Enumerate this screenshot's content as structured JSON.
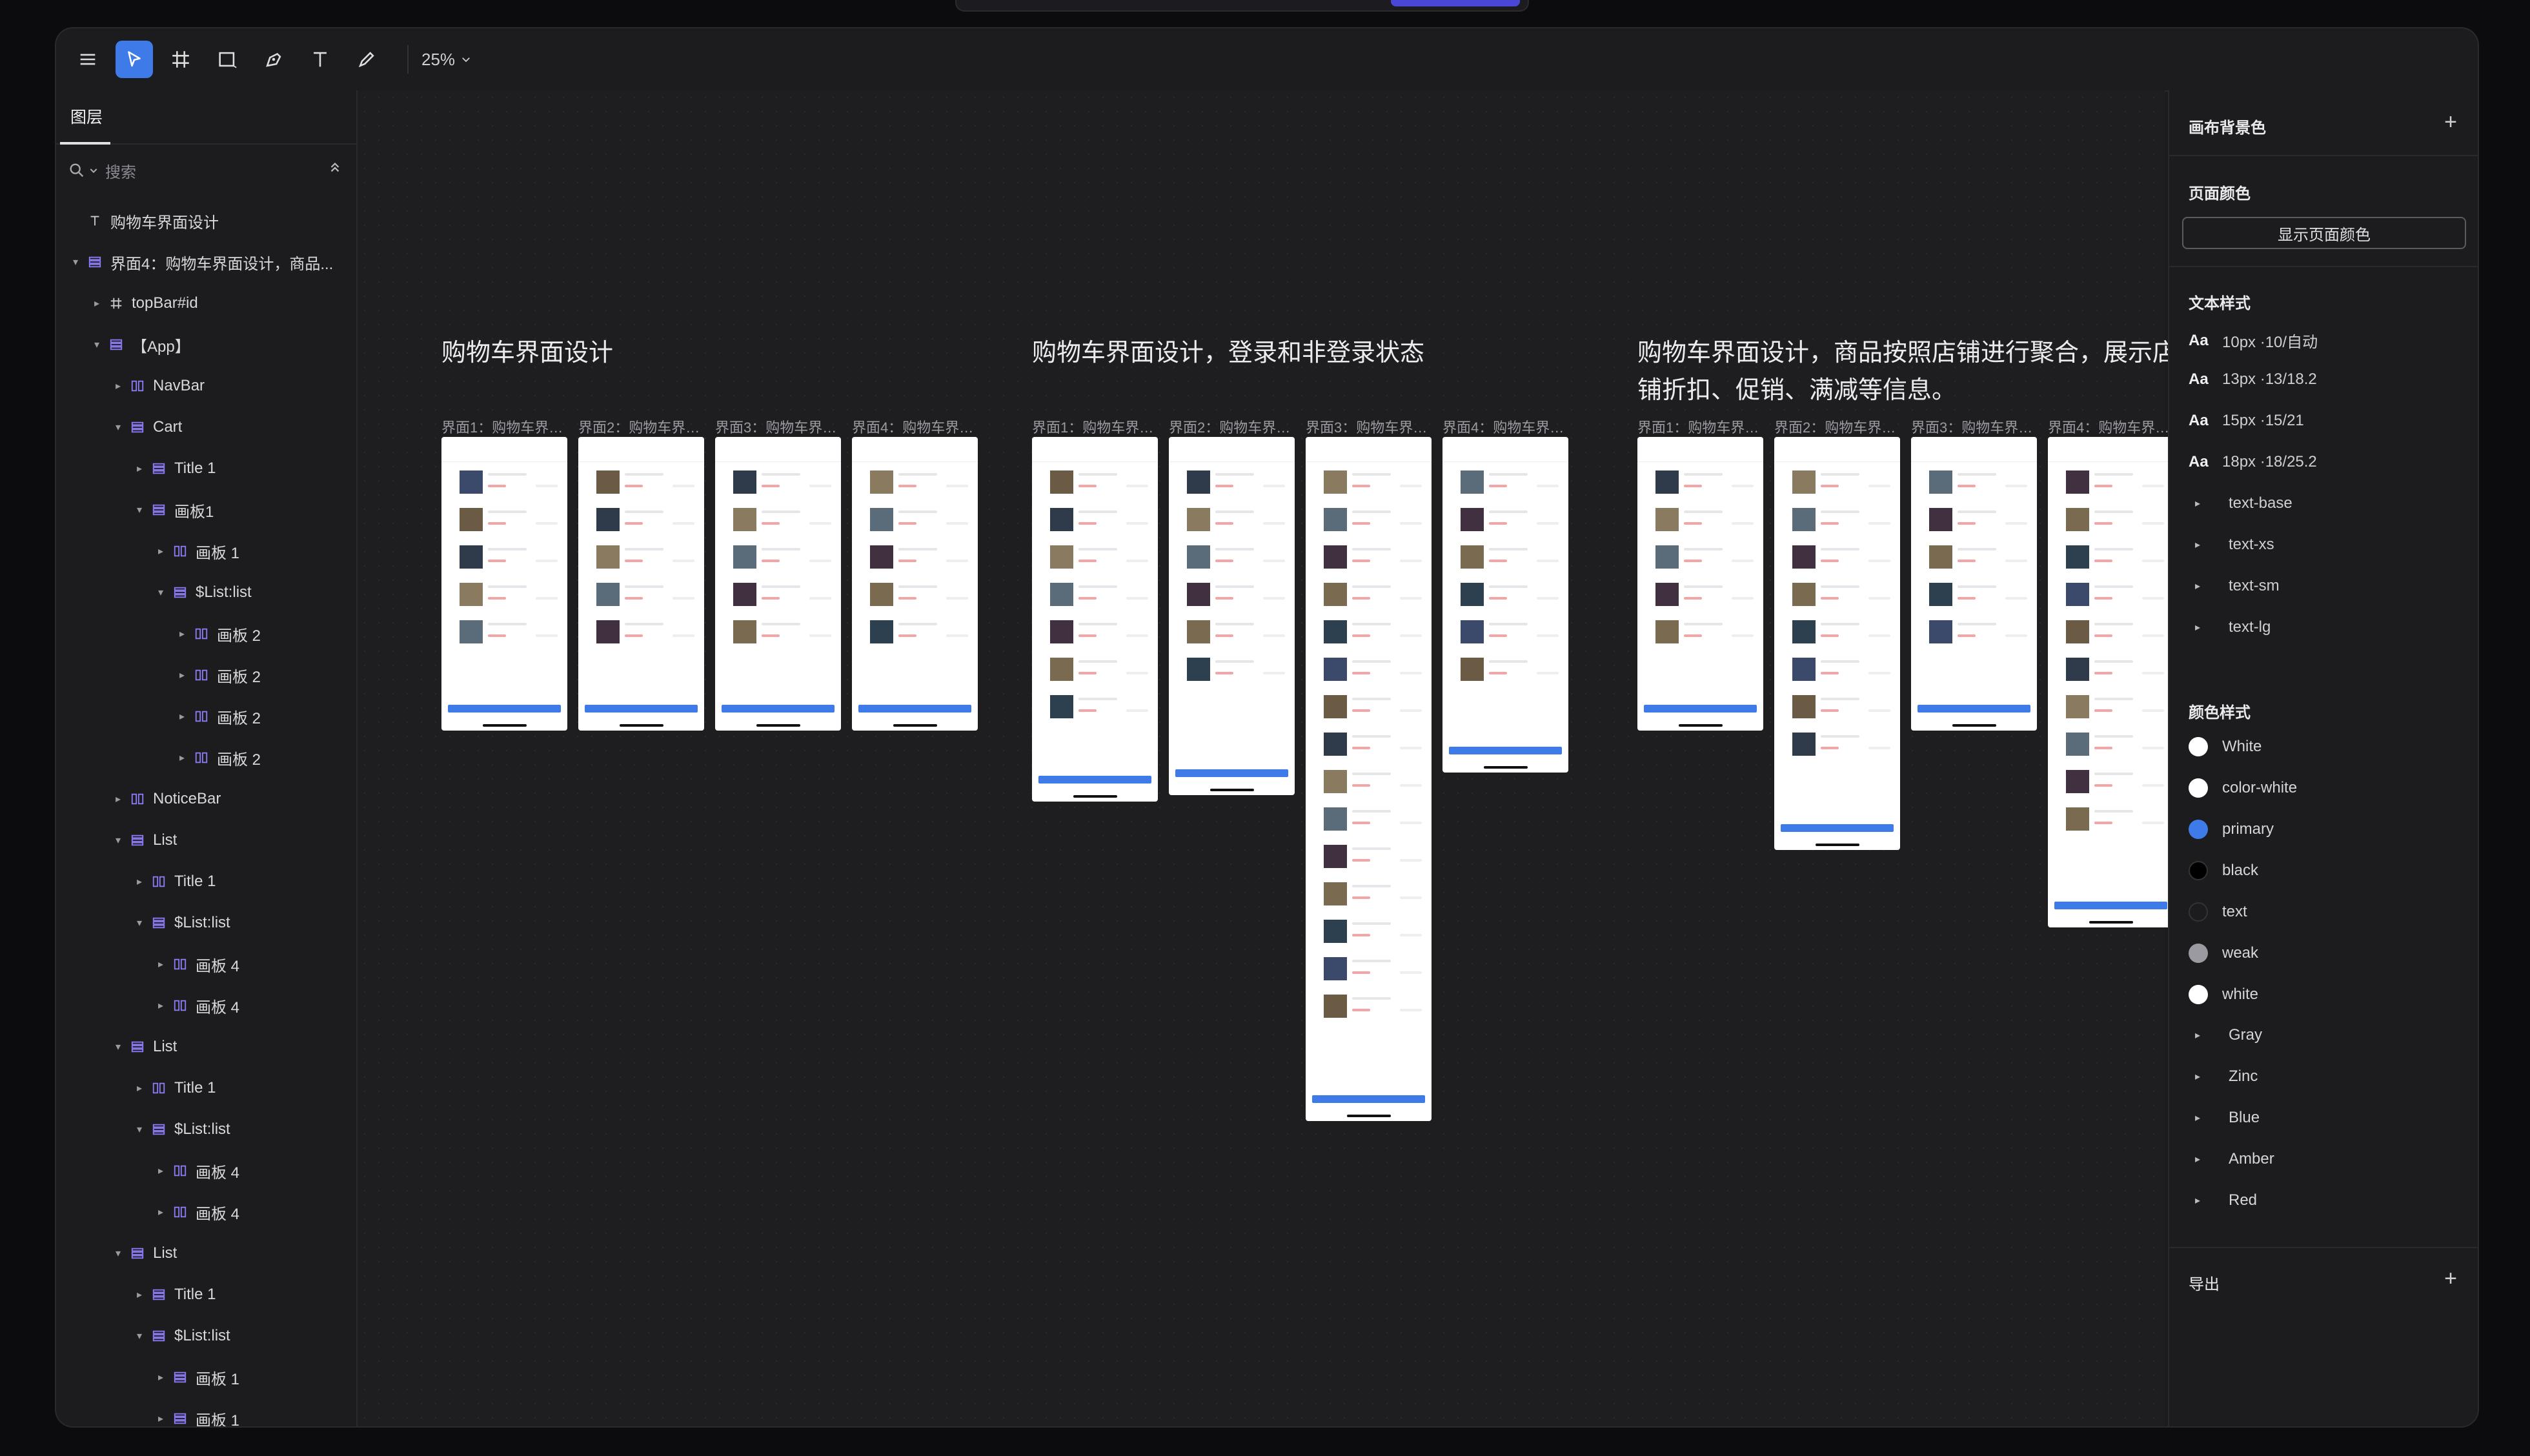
{
  "toolbar": {
    "zoom": "25%",
    "tools": [
      "menu-icon",
      "select-icon",
      "frame-icon",
      "rectangle-icon",
      "pen-icon",
      "text-icon",
      "pencil-icon"
    ]
  },
  "layers_panel": {
    "tab": "图层",
    "search_placeholder": "搜索",
    "items": [
      {
        "label": "购物车界面设计",
        "type": "text",
        "depth": 0,
        "caret": ""
      },
      {
        "label": "界面4：购物车界面设计，商品...",
        "type": "stack",
        "depth": 0,
        "caret": "▾"
      },
      {
        "label": "topBar#id",
        "type": "frame",
        "depth": 1,
        "caret": "▸"
      },
      {
        "label": "【App】",
        "type": "stack",
        "depth": 1,
        "caret": "▾"
      },
      {
        "label": "NavBar",
        "type": "hstack",
        "depth": 2,
        "caret": "▸"
      },
      {
        "label": "Cart",
        "type": "stack",
        "depth": 2,
        "caret": "▾"
      },
      {
        "label": "Title 1",
        "type": "stack",
        "depth": 3,
        "caret": "▸"
      },
      {
        "label": "画板1",
        "type": "stack",
        "depth": 3,
        "caret": "▾"
      },
      {
        "label": "画板 1",
        "type": "hstack",
        "depth": 4,
        "caret": "▸"
      },
      {
        "label": "$List:list",
        "type": "stack",
        "depth": 4,
        "caret": "▾"
      },
      {
        "label": "画板 2",
        "type": "hstack",
        "depth": 5,
        "caret": "▸"
      },
      {
        "label": "画板 2",
        "type": "hstack",
        "depth": 5,
        "caret": "▸"
      },
      {
        "label": "画板 2",
        "type": "hstack",
        "depth": 5,
        "caret": "▸"
      },
      {
        "label": "画板 2",
        "type": "hstack",
        "depth": 5,
        "caret": "▸"
      },
      {
        "label": "NoticeBar",
        "type": "hstack",
        "depth": 2,
        "caret": "▸"
      },
      {
        "label": "List",
        "type": "stack",
        "depth": 2,
        "caret": "▾"
      },
      {
        "label": "Title 1",
        "type": "hstack",
        "depth": 3,
        "caret": "▸"
      },
      {
        "label": "$List:list",
        "type": "stack",
        "depth": 3,
        "caret": "▾"
      },
      {
        "label": "画板 4",
        "type": "hstack",
        "depth": 4,
        "caret": "▸"
      },
      {
        "label": "画板 4",
        "type": "hstack",
        "depth": 4,
        "caret": "▸"
      },
      {
        "label": "List",
        "type": "stack",
        "depth": 2,
        "caret": "▾"
      },
      {
        "label": "Title 1",
        "type": "hstack",
        "depth": 3,
        "caret": "▸"
      },
      {
        "label": "$List:list",
        "type": "stack",
        "depth": 3,
        "caret": "▾"
      },
      {
        "label": "画板 4",
        "type": "hstack",
        "depth": 4,
        "caret": "▸"
      },
      {
        "label": "画板 4",
        "type": "hstack",
        "depth": 4,
        "caret": "▸"
      },
      {
        "label": "List",
        "type": "stack",
        "depth": 2,
        "caret": "▾"
      },
      {
        "label": "Title 1",
        "type": "stack",
        "depth": 3,
        "caret": "▸"
      },
      {
        "label": "$List:list",
        "type": "stack",
        "depth": 3,
        "caret": "▾"
      },
      {
        "label": "画板 1",
        "type": "stack",
        "depth": 4,
        "caret": "▸"
      },
      {
        "label": "画板 1",
        "type": "stack",
        "depth": 4,
        "caret": "▸"
      }
    ]
  },
  "canvas": {
    "groups": [
      {
        "title": "购物车界面设计",
        "frames": [
          "界面1：购物车界…",
          "界面2：购物车界…",
          "界面3：购物车界…",
          "界面4：购物车界…"
        ]
      },
      {
        "title": "购物车界面设计，登录和非登录状态",
        "frames": [
          "界面1：购物车界…",
          "界面2：购物车界…",
          "界面3：购物车界…",
          "界面4：购物车界…"
        ]
      },
      {
        "title": "购物车界面设计，商品按照店铺进行聚合，展示店铺折扣、促销、满减等信息。",
        "frames": [
          "界面1：购物车界…",
          "界面2：购物车界…",
          "界面3：购物车界…",
          "界面4：购物车界…"
        ]
      }
    ]
  },
  "right_panel": {
    "canvas_bg": "画布背景色",
    "page_color": "页面颜色",
    "show_page_color": "显示页面颜色",
    "text_styles_title": "文本样式",
    "text_styles": [
      {
        "label": "10px ·10/自动",
        "kind": "aa"
      },
      {
        "label": "13px ·13/18.2",
        "kind": "aa"
      },
      {
        "label": "15px ·15/21",
        "kind": "aa"
      },
      {
        "label": "18px ·18/25.2",
        "kind": "aa"
      },
      {
        "label": "text-base",
        "kind": "group"
      },
      {
        "label": "text-xs",
        "kind": "group"
      },
      {
        "label": "text-sm",
        "kind": "group"
      },
      {
        "label": "text-lg",
        "kind": "group"
      }
    ],
    "color_styles_title": "颜色样式",
    "color_styles": [
      {
        "label": "White",
        "color": "#ffffff",
        "kind": "swatch"
      },
      {
        "label": "color-white",
        "color": "#ffffff",
        "kind": "swatch"
      },
      {
        "label": "primary",
        "color": "#3e7be8",
        "kind": "swatch"
      },
      {
        "label": "black",
        "color": "#000000",
        "kind": "swatch"
      },
      {
        "label": "text",
        "color": "#1c1c1f",
        "kind": "swatch"
      },
      {
        "label": "weak",
        "color": "#9a9aa0",
        "kind": "swatch"
      },
      {
        "label": "white",
        "color": "#ffffff",
        "kind": "swatch"
      },
      {
        "label": "Gray",
        "kind": "group"
      },
      {
        "label": "Zinc",
        "kind": "group"
      },
      {
        "label": "Blue",
        "kind": "group"
      },
      {
        "label": "Amber",
        "kind": "group"
      },
      {
        "label": "Red",
        "kind": "group"
      }
    ],
    "export": "导出"
  }
}
